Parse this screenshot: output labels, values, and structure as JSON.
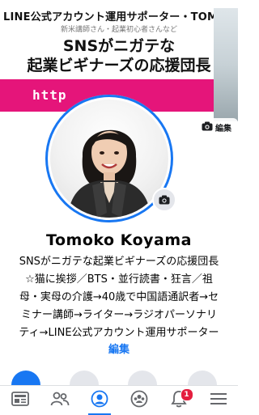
{
  "cover": {
    "line1": "LINE公式アカウント運用サポーター・TOMO",
    "line2": "新米講師さん・起業初心者さんなど",
    "line3": "SNSがニガテな",
    "line4": "起業ビギナーズの応援団長",
    "url_text": "http",
    "edit_label": "編集",
    "band_color": "#e5157a"
  },
  "profile": {
    "name": "Tomoko  Koyama",
    "bio_lines": [
      "SNSがニガテな起業ビギナーズの応援団長",
      "☆猫に挨拶／BTS・並行読書・狂言／祖",
      "母・実母の介護→40歳で中国語通訳者→セ",
      "ミナー講師→ライター→ラジオパーソナリ",
      "ティ→LINE公式アカウント運用サポーター"
    ],
    "bio_edit_label": "編集"
  },
  "tabbar": {
    "accent": "#1877f2",
    "notification_count": "1",
    "tabs": [
      {
        "icon": "news-feed-icon"
      },
      {
        "icon": "friends-icon"
      },
      {
        "icon": "profile-icon"
      },
      {
        "icon": "groups-icon"
      },
      {
        "icon": "notifications-bell-icon"
      },
      {
        "icon": "menu-icon"
      }
    ]
  }
}
